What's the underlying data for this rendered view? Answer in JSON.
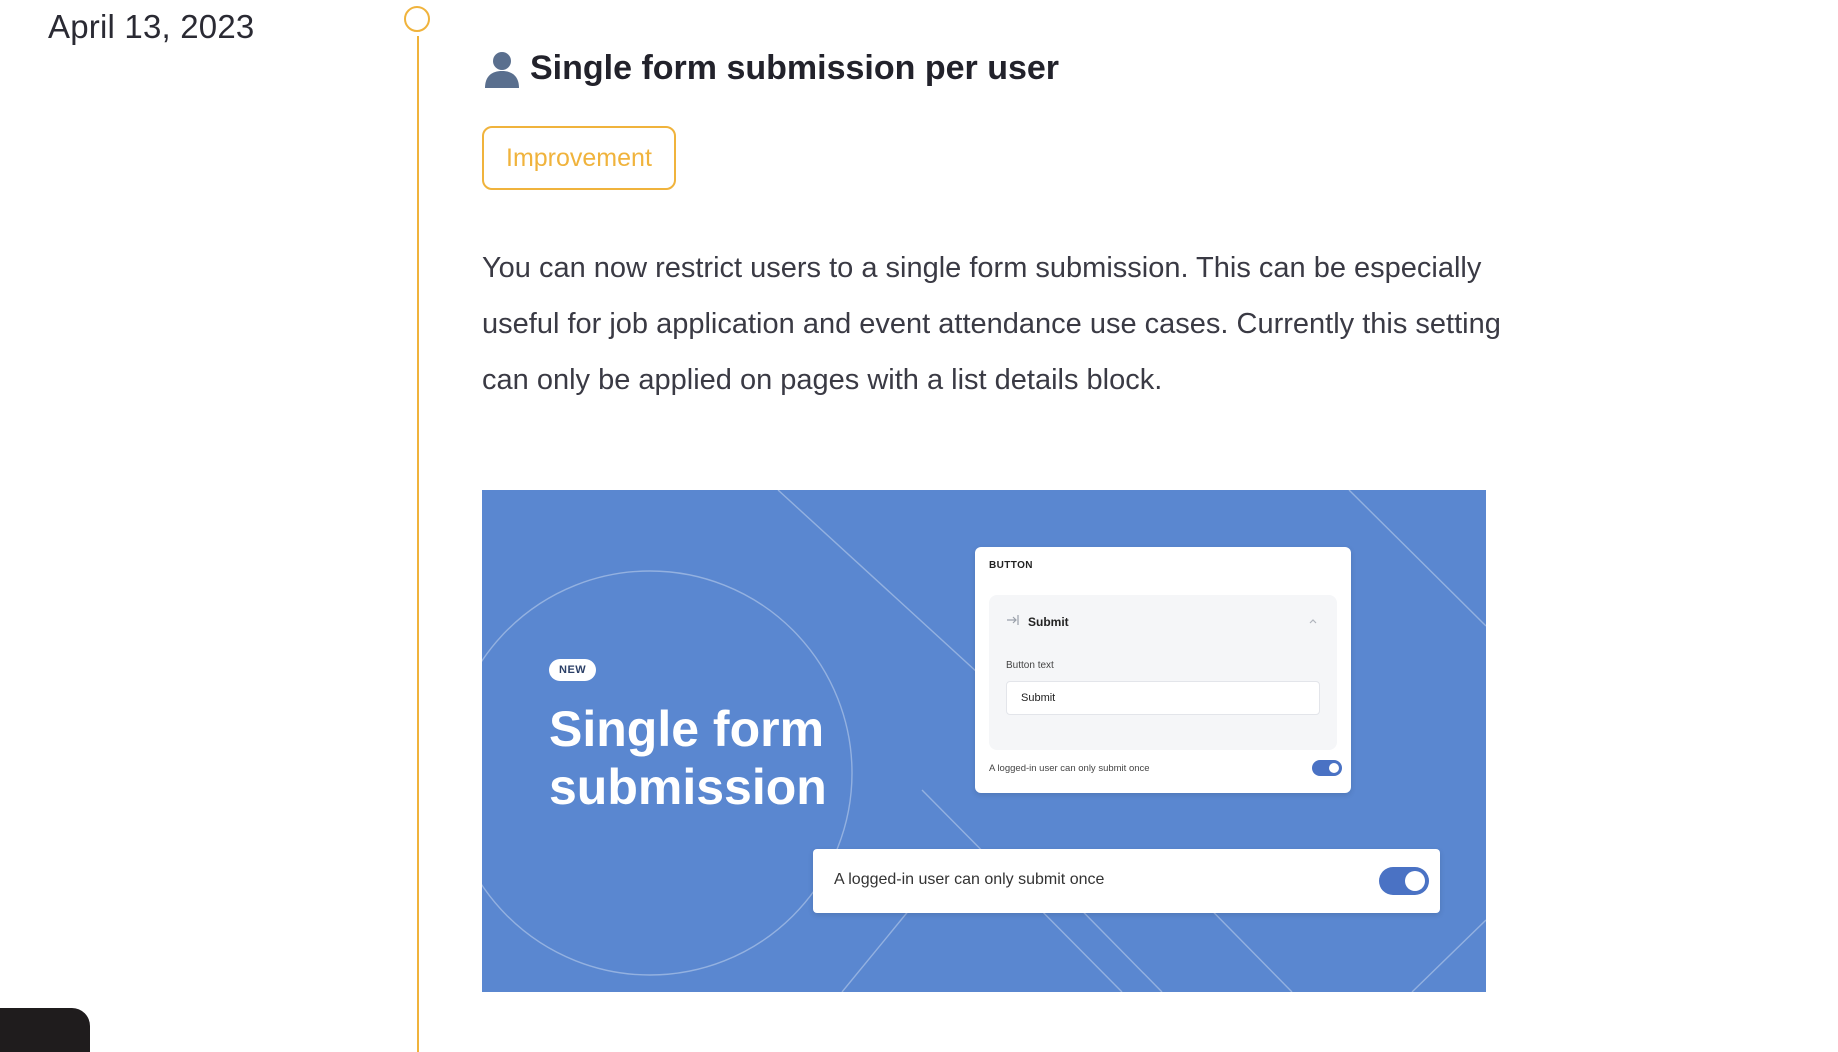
{
  "entry": {
    "date": "April 13, 2023",
    "title_icon": "user-silhouette-icon",
    "title": "Single form submission per user",
    "tag": "Improvement",
    "description": "You can now restrict users to a single form submission. This can be especially useful for job application and event attendance use cases. Currently this setting can only be applied on pages with a list details block."
  },
  "hero": {
    "badge": "NEW",
    "title": "Single form submission",
    "card": {
      "heading": "BUTTON",
      "submit_icon": "enter-arrow-icon",
      "submit_label": "Submit",
      "field_label": "Button text",
      "field_value": "Submit",
      "toggle_label": "A logged-in user can only submit once",
      "toggle_on": true
    },
    "toggle_bar": {
      "label": "A logged-in user can only submit once",
      "toggle_on": true
    }
  },
  "colors": {
    "accent": "#f0b33c",
    "hero_bg": "#5a87d0",
    "toggle": "#4a72c4"
  }
}
